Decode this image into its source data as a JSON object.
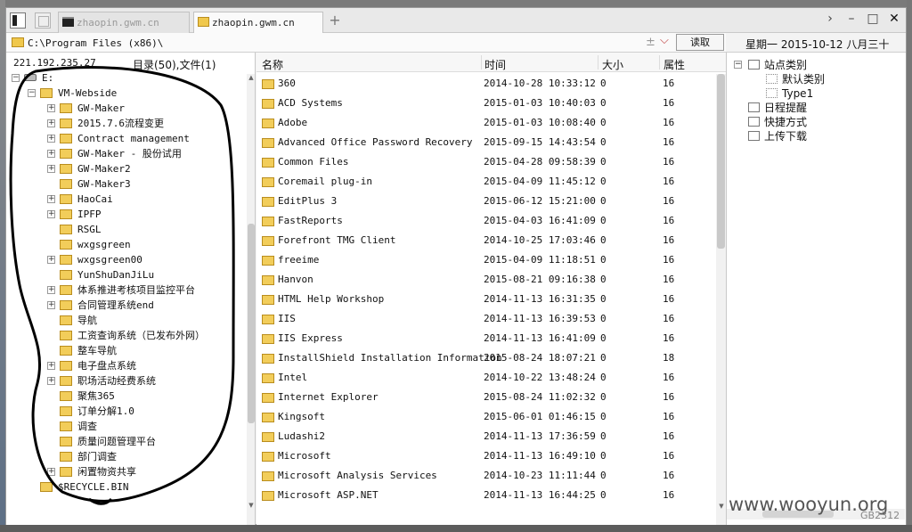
{
  "tabs": [
    {
      "label": "zhaopin.gwm.cn",
      "icon": "terminal-icon",
      "active": false
    },
    {
      "label": "zhaopin.gwm.cn",
      "icon": "folder-icon",
      "active": true
    }
  ],
  "tab_add": "+",
  "window_controls": {
    "chevron": "›",
    "minimize": "–",
    "maximize": "□",
    "close": "✕"
  },
  "address": {
    "path": "C:\\Program Files (x86)\\",
    "plus": "±",
    "dropdown": "⌵",
    "read_button": "读取"
  },
  "date": "星期一 2015-10-12 八月三十",
  "left_panel": {
    "ip": "221.192.235.27",
    "summary": "目录(50),文件(1)",
    "tree": [
      {
        "label": "E:",
        "level": 0,
        "expand": "−",
        "drive": true
      },
      {
        "label": "VM-Webside",
        "level": 1,
        "expand": "−"
      },
      {
        "label": "GW-Maker",
        "level": 2,
        "expand": "+"
      },
      {
        "label": "2015.7.6流程变更",
        "level": 2,
        "expand": "+"
      },
      {
        "label": "Contract management",
        "level": 2,
        "expand": "+"
      },
      {
        "label": "GW-Maker - 股份试用",
        "level": 2,
        "expand": "+"
      },
      {
        "label": "GW-Maker2",
        "level": 2,
        "expand": "+"
      },
      {
        "label": "GW-Maker3",
        "level": 2,
        "expand": ""
      },
      {
        "label": "HaoCai",
        "level": 2,
        "expand": "+"
      },
      {
        "label": "IPFP",
        "level": 2,
        "expand": "+"
      },
      {
        "label": "RSGL",
        "level": 2,
        "expand": ""
      },
      {
        "label": "wxgsgreen",
        "level": 2,
        "expand": ""
      },
      {
        "label": "wxgsgreen00",
        "level": 2,
        "expand": "+"
      },
      {
        "label": "YunShuDanJiLu",
        "level": 2,
        "expand": ""
      },
      {
        "label": "体系推进考核项目监控平台",
        "level": 2,
        "expand": "+"
      },
      {
        "label": "合同管理系统end",
        "level": 2,
        "expand": "+"
      },
      {
        "label": "导航",
        "level": 2,
        "expand": ""
      },
      {
        "label": "工资查询系统（已发布外网）",
        "level": 2,
        "expand": ""
      },
      {
        "label": "整车导航",
        "level": 2,
        "expand": ""
      },
      {
        "label": "电子盘点系统",
        "level": 2,
        "expand": "+"
      },
      {
        "label": "职场活动经费系统",
        "level": 2,
        "expand": "+"
      },
      {
        "label": "聚焦365",
        "level": 2,
        "expand": ""
      },
      {
        "label": "订单分解1.0",
        "level": 2,
        "expand": ""
      },
      {
        "label": "调查",
        "level": 2,
        "expand": ""
      },
      {
        "label": "质量问题管理平台",
        "level": 2,
        "expand": ""
      },
      {
        "label": "部门调查",
        "level": 2,
        "expand": ""
      },
      {
        "label": "闲置物资共享",
        "level": 2,
        "expand": "+"
      },
      {
        "label": "$RECYCLE.BIN",
        "level": 1,
        "expand": ""
      }
    ]
  },
  "file_list": {
    "columns": {
      "name": "名称",
      "time": "时间",
      "size": "大小",
      "attr": "属性"
    },
    "rows": [
      {
        "name": "360",
        "time": "2014-10-28 10:33:12",
        "size": "0",
        "attr": "16"
      },
      {
        "name": "ACD Systems",
        "time": "2015-01-03 10:40:03",
        "size": "0",
        "attr": "16"
      },
      {
        "name": "Adobe",
        "time": "2015-01-03 10:08:40",
        "size": "0",
        "attr": "16"
      },
      {
        "name": "Advanced Office Password Recovery",
        "time": "2015-09-15 14:43:54",
        "size": "0",
        "attr": "16"
      },
      {
        "name": "Common Files",
        "time": "2015-04-28 09:58:39",
        "size": "0",
        "attr": "16"
      },
      {
        "name": "Coremail plug-in",
        "time": "2015-04-09 11:45:12",
        "size": "0",
        "attr": "16"
      },
      {
        "name": "EditPlus 3",
        "time": "2015-06-12 15:21:00",
        "size": "0",
        "attr": "16"
      },
      {
        "name": "FastReports",
        "time": "2015-04-03 16:41:09",
        "size": "0",
        "attr": "16"
      },
      {
        "name": "Forefront TMG Client",
        "time": "2014-10-25 17:03:46",
        "size": "0",
        "attr": "16"
      },
      {
        "name": "freeime",
        "time": "2015-04-09 11:18:51",
        "size": "0",
        "attr": "16"
      },
      {
        "name": "Hanvon",
        "time": "2015-08-21 09:16:38",
        "size": "0",
        "attr": "16"
      },
      {
        "name": "HTML Help Workshop",
        "time": "2014-11-13 16:31:35",
        "size": "0",
        "attr": "16"
      },
      {
        "name": "IIS",
        "time": "2014-11-13 16:39:53",
        "size": "0",
        "attr": "16"
      },
      {
        "name": "IIS Express",
        "time": "2014-11-13 16:41:09",
        "size": "0",
        "attr": "16"
      },
      {
        "name": "InstallShield Installation Information",
        "time": "2015-08-24 18:07:21",
        "size": "0",
        "attr": "18"
      },
      {
        "name": "Intel",
        "time": "2014-10-22 13:48:24",
        "size": "0",
        "attr": "16"
      },
      {
        "name": "Internet Explorer",
        "time": "2015-08-24 11:02:32",
        "size": "0",
        "attr": "16"
      },
      {
        "name": "Kingsoft",
        "time": "2015-06-01 01:46:15",
        "size": "0",
        "attr": "16"
      },
      {
        "name": "Ludashi2",
        "time": "2014-11-13 17:36:59",
        "size": "0",
        "attr": "16"
      },
      {
        "name": "Microsoft",
        "time": "2014-11-13 16:49:10",
        "size": "0",
        "attr": "16"
      },
      {
        "name": "Microsoft Analysis Services",
        "time": "2014-10-23 11:11:44",
        "size": "0",
        "attr": "16"
      },
      {
        "name": "Microsoft ASP.NET",
        "time": "2014-11-13 16:44:25",
        "size": "0",
        "attr": "16"
      }
    ]
  },
  "right_panel": {
    "items": [
      {
        "label": "站点类别",
        "expand": "−",
        "icon": "category-icon",
        "level": 0
      },
      {
        "label": "默认类别",
        "expand": "",
        "icon": "dotted-box-icon",
        "level": 1
      },
      {
        "label": "Type1",
        "expand": "",
        "icon": "dotted-box-icon",
        "level": 1
      },
      {
        "label": "日程提醒",
        "expand": "",
        "icon": "clock-icon",
        "level": 0
      },
      {
        "label": "快捷方式",
        "expand": "",
        "icon": "shortcut-icon",
        "level": 0
      },
      {
        "label": "上传下载",
        "expand": "",
        "icon": "transfer-icon",
        "level": 0
      }
    ]
  },
  "watermark": {
    "text": "www.wooyun.org",
    "sub": "GB2312"
  },
  "colors": {
    "folder": "#f2cd5a",
    "annotation": "#000000",
    "window_bg": "#f3f3f3"
  }
}
